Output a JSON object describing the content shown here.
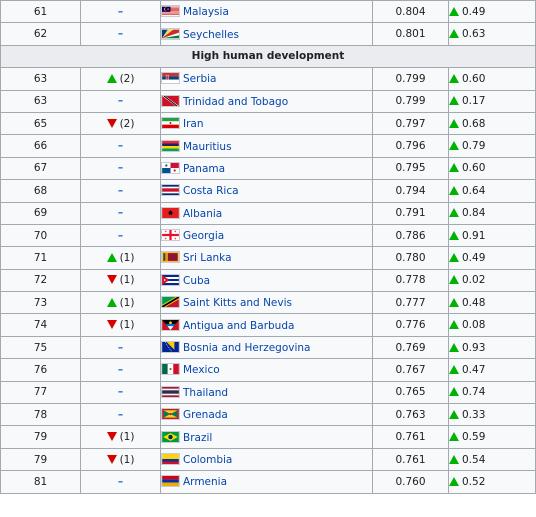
{
  "group_header": "High human development",
  "rows_before": [
    {
      "rank": "61",
      "change": "–",
      "change_dir": "none",
      "country": "Malaysia",
      "flag": "malaysia",
      "hdi": "0.804",
      "avg": "0.49"
    },
    {
      "rank": "62",
      "change": "–",
      "change_dir": "none",
      "country": "Seychelles",
      "flag": "seychelles",
      "hdi": "0.801",
      "avg": "0.63"
    }
  ],
  "rows_after": [
    {
      "rank": "63",
      "change": "(2)",
      "change_dir": "up",
      "country": "Serbia",
      "flag": "serbia",
      "hdi": "0.799",
      "avg": "0.60"
    },
    {
      "rank": "63",
      "change": "–",
      "change_dir": "none",
      "country": "Trinidad and Tobago",
      "flag": "trinidad",
      "hdi": "0.799",
      "avg": "0.17"
    },
    {
      "rank": "65",
      "change": "(2)",
      "change_dir": "down",
      "country": "Iran",
      "flag": "iran",
      "hdi": "0.797",
      "avg": "0.68"
    },
    {
      "rank": "66",
      "change": "–",
      "change_dir": "none",
      "country": "Mauritius",
      "flag": "mauritius",
      "hdi": "0.796",
      "avg": "0.79"
    },
    {
      "rank": "67",
      "change": "–",
      "change_dir": "none",
      "country": "Panama",
      "flag": "panama",
      "hdi": "0.795",
      "avg": "0.60"
    },
    {
      "rank": "68",
      "change": "–",
      "change_dir": "none",
      "country": "Costa Rica",
      "flag": "costarica",
      "hdi": "0.794",
      "avg": "0.64"
    },
    {
      "rank": "69",
      "change": "–",
      "change_dir": "none",
      "country": "Albania",
      "flag": "albania",
      "hdi": "0.791",
      "avg": "0.84"
    },
    {
      "rank": "70",
      "change": "–",
      "change_dir": "none",
      "country": "Georgia",
      "flag": "georgia",
      "hdi": "0.786",
      "avg": "0.91"
    },
    {
      "rank": "71",
      "change": "(1)",
      "change_dir": "up",
      "country": "Sri Lanka",
      "flag": "srilanka",
      "hdi": "0.780",
      "avg": "0.49"
    },
    {
      "rank": "72",
      "change": "(1)",
      "change_dir": "down",
      "country": "Cuba",
      "flag": "cuba",
      "hdi": "0.778",
      "avg": "0.02"
    },
    {
      "rank": "73",
      "change": "(1)",
      "change_dir": "up",
      "country": "Saint Kitts and Nevis",
      "flag": "stkitts",
      "hdi": "0.777",
      "avg": "0.48"
    },
    {
      "rank": "74",
      "change": "(1)",
      "change_dir": "down",
      "country": "Antigua and Barbuda",
      "flag": "antigua",
      "hdi": "0.776",
      "avg": "0.08"
    },
    {
      "rank": "75",
      "change": "–",
      "change_dir": "none",
      "country": "Bosnia and Herzegovina",
      "flag": "bosnia",
      "hdi": "0.769",
      "avg": "0.93"
    },
    {
      "rank": "76",
      "change": "–",
      "change_dir": "none",
      "country": "Mexico",
      "flag": "mexico",
      "hdi": "0.767",
      "avg": "0.47"
    },
    {
      "rank": "77",
      "change": "–",
      "change_dir": "none",
      "country": "Thailand",
      "flag": "thailand",
      "hdi": "0.765",
      "avg": "0.74"
    },
    {
      "rank": "78",
      "change": "–",
      "change_dir": "none",
      "country": "Grenada",
      "flag": "grenada",
      "hdi": "0.763",
      "avg": "0.33"
    },
    {
      "rank": "79",
      "change": "(1)",
      "change_dir": "down",
      "country": "Brazil",
      "flag": "brazil",
      "hdi": "0.761",
      "avg": "0.59"
    },
    {
      "rank": "79",
      "change": "(1)",
      "change_dir": "down",
      "country": "Colombia",
      "flag": "colombia",
      "hdi": "0.761",
      "avg": "0.54"
    },
    {
      "rank": "81",
      "change": "–",
      "change_dir": "none",
      "country": "Armenia",
      "flag": "armenia",
      "hdi": "0.760",
      "avg": "0.52"
    }
  ]
}
